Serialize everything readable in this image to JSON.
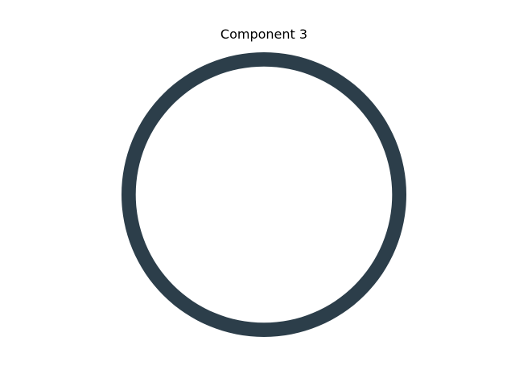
{
  "chart_data": {
    "type": "pie",
    "title": "Component 3",
    "slices": [
      {
        "label": "",
        "value": 1,
        "color": "#2c3e4a"
      }
    ],
    "style": "donut",
    "hole_fraction": 0.9,
    "legend": "none"
  }
}
